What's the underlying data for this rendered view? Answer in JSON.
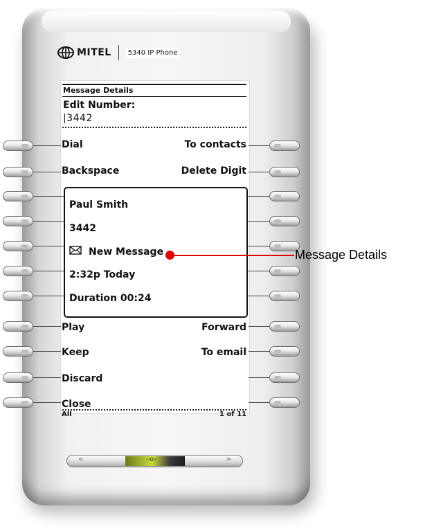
{
  "brand": {
    "name": "MITEL",
    "model": "5340 IP Phone",
    "logo_icon": "mitel-globe-icon"
  },
  "screen": {
    "title": "Message Details",
    "edit_label": "Edit Number:",
    "edit_value": "|3442",
    "softkeys": [
      {
        "left": "Dial",
        "right": "To contacts"
      },
      {
        "left": "Backspace",
        "right": "Delete Digit"
      }
    ],
    "message": {
      "name": "Paul Smith",
      "number": "3442",
      "status": "New Message",
      "status_icon": "envelope-icon",
      "time": "2:32p Today",
      "duration": "Duration 00:24"
    },
    "actions": [
      {
        "left": "Play",
        "right": "Forward"
      },
      {
        "left": "Keep",
        "right": "To email"
      },
      {
        "left": "Discard",
        "right": ""
      },
      {
        "left": "Close",
        "right": ""
      }
    ],
    "footer": {
      "left": "All",
      "right": "1 of 11"
    }
  },
  "callout": {
    "label": "Message Details",
    "color": "#e00000"
  },
  "navigation": {
    "left_glyph": "<",
    "right_glyph": ">",
    "center_glyph": "-o-"
  }
}
